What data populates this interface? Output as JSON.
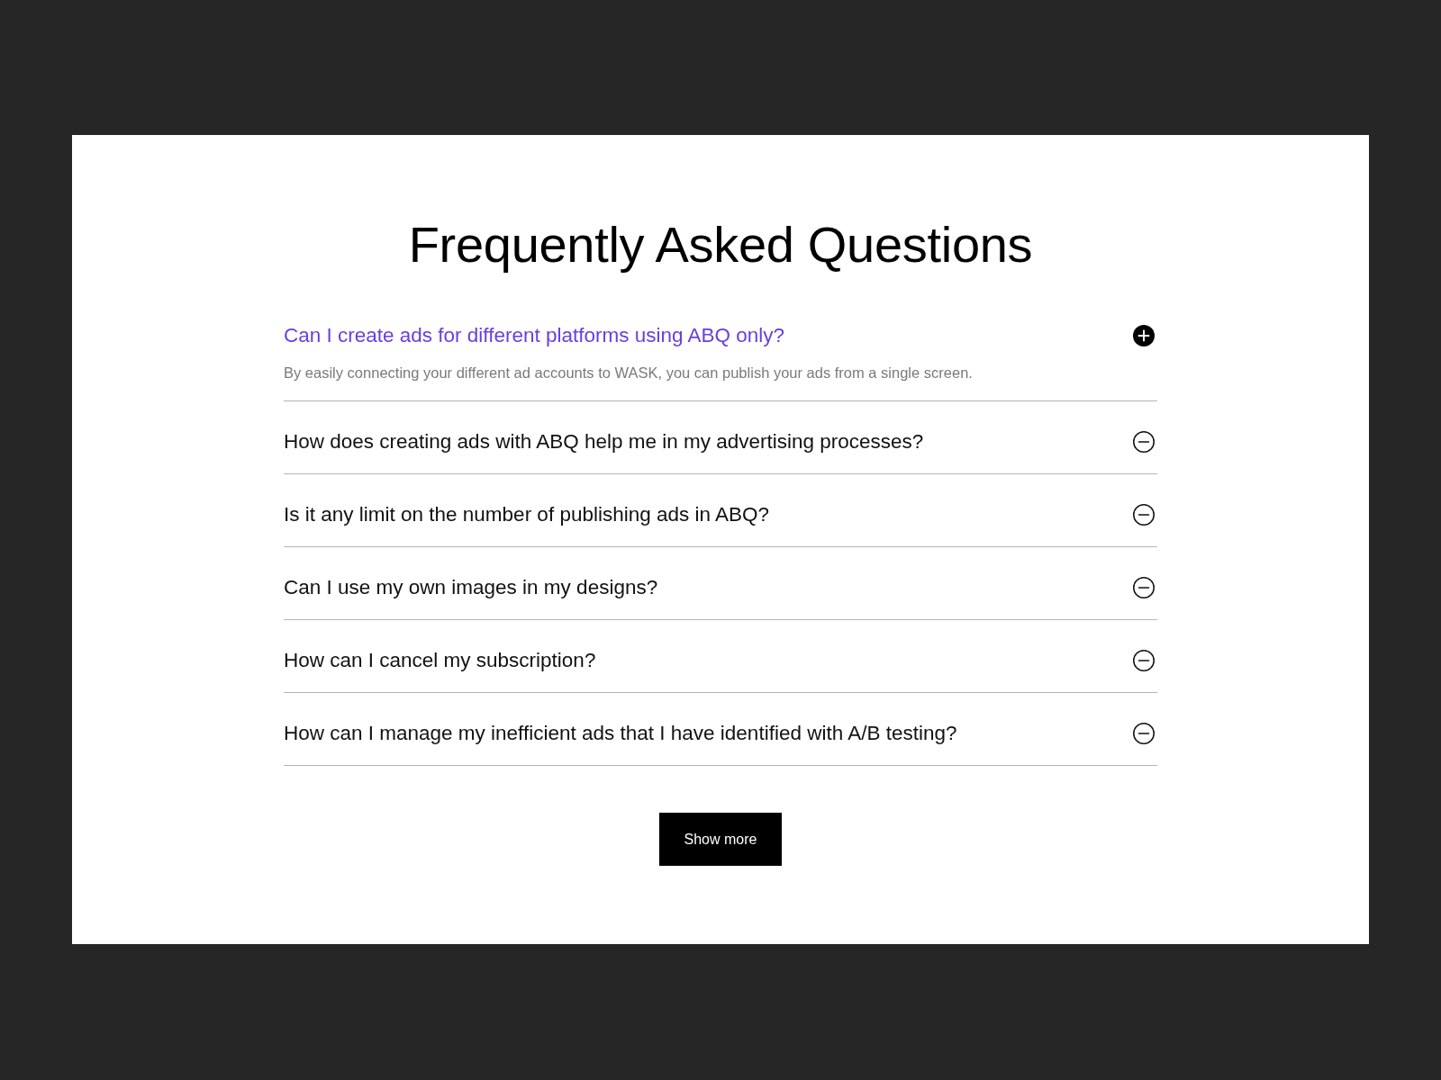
{
  "title": "Frequently Asked Questions",
  "faq": [
    {
      "question": "Can I create ads for different platforms using ABQ only?",
      "answer": "By easily connecting your different ad accounts to WASK, you can publish your ads from a single screen.",
      "expanded": true
    },
    {
      "question": "How does creating ads with ABQ help me in my advertising processes?",
      "expanded": false
    },
    {
      "question": "Is it any limit on the number of publishing ads in ABQ?",
      "expanded": false
    },
    {
      "question": "Can I use my own images in my designs?",
      "expanded": false
    },
    {
      "question": "How can I cancel my subscription?",
      "expanded": false
    },
    {
      "question": "How can I manage my inefficient ads that I have identified with A/B testing?",
      "expanded": false
    }
  ],
  "show_more_button": "Show more"
}
